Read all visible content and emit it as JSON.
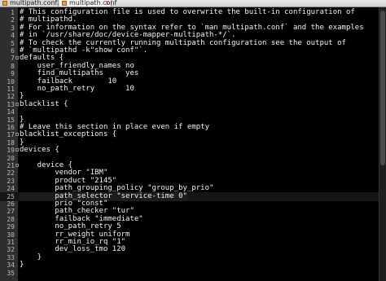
{
  "tabs": [
    {
      "label": "multipath.conf.old",
      "active": false
    },
    {
      "label": "multipath.conf",
      "active": true,
      "close": "X"
    }
  ],
  "lines": [
    {
      "num": "1",
      "text": "# This configuration file is used to overwrite the built-in configuration of"
    },
    {
      "num": "2",
      "text": "# multipathd."
    },
    {
      "num": "3",
      "text": "# For information on the syntax refer to `man multipath.conf` and the examples"
    },
    {
      "num": "4",
      "text": "# in `/usr/share/doc/device-mapper-multipath-*/`."
    },
    {
      "num": "5",
      "text": "# To check the currently running multipath configuration see the output of"
    },
    {
      "num": "6",
      "text": "# `multipathd -k\"show conf\"`."
    },
    {
      "num": "7",
      "text": "defaults {"
    },
    {
      "num": "8",
      "text": "    user_friendly_names no"
    },
    {
      "num": "9",
      "text": "    find_multipaths     yes"
    },
    {
      "num": "10",
      "text": "    failback        10"
    },
    {
      "num": "11",
      "text": "    no_path_retry       10"
    },
    {
      "num": "12",
      "text": "}"
    },
    {
      "num": "13",
      "text": "blacklist {"
    },
    {
      "num": "14",
      "text": ""
    },
    {
      "num": "15",
      "text": "}"
    },
    {
      "num": "16",
      "text": "# Leave this section in place even if empty"
    },
    {
      "num": "17",
      "text": "blacklist_exceptions {"
    },
    {
      "num": "18",
      "text": "}"
    },
    {
      "num": "19",
      "text": "devices {"
    },
    {
      "num": "20",
      "text": ""
    },
    {
      "num": "21",
      "text": "    device {"
    },
    {
      "num": "22",
      "text": "        vendor \"IBM\""
    },
    {
      "num": "23",
      "text": "        product \"2145\""
    },
    {
      "num": "24",
      "text": "        path_grouping_policy \"group_by_prio\""
    },
    {
      "num": "25",
      "text": "        path_selector \"service-time 0\"",
      "highlight": true
    },
    {
      "num": "26",
      "text": "        prio \"const\""
    },
    {
      "num": "27",
      "text": "        path_checker \"tur\""
    },
    {
      "num": "28",
      "text": "        failback \"immediate\""
    },
    {
      "num": "29",
      "text": "        no_path_retry 5"
    },
    {
      "num": "30",
      "text": "        rr_weight uniform"
    },
    {
      "num": "31",
      "text": "        rr_min_io_rq \"1\""
    },
    {
      "num": "32",
      "text": "        dev_loss_tmo 120"
    },
    {
      "num": "33",
      "text": "    }"
    },
    {
      "num": "34",
      "text": "}"
    },
    {
      "num": "35",
      "text": ""
    }
  ],
  "colors": {
    "background": "#000000",
    "text": "#f2f2f2",
    "gutter": "#2e2e2e"
  }
}
